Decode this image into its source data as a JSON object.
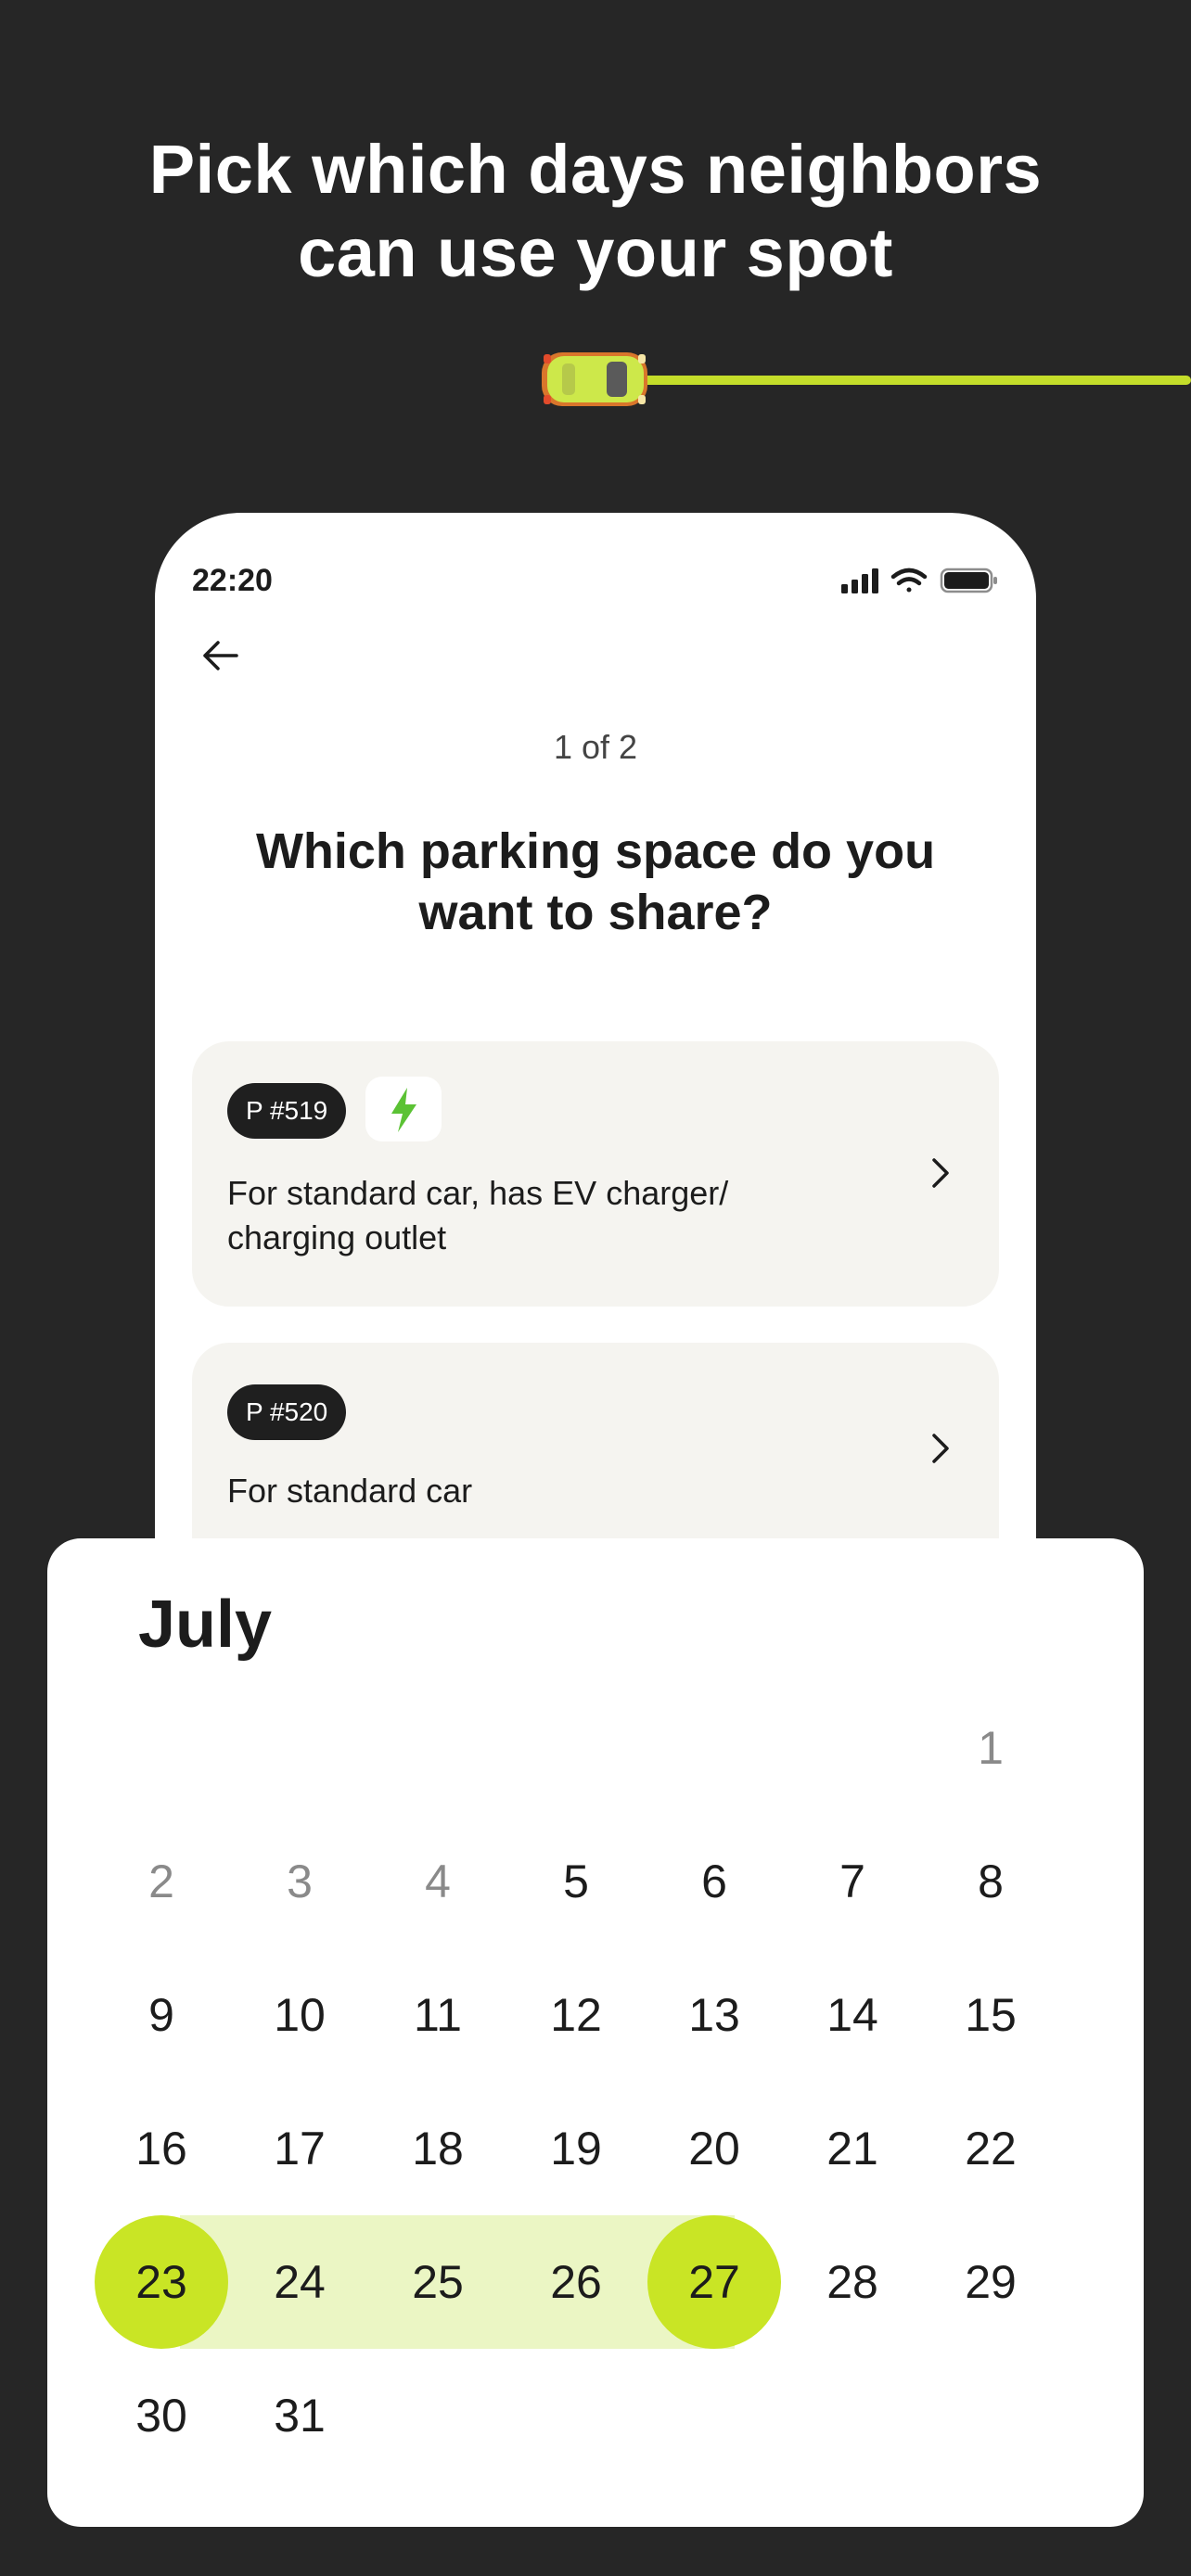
{
  "headline": {
    "line1": "Pick which days neighbors",
    "line2": "can use your spot"
  },
  "colors": {
    "background": "#262626",
    "accent": "#c4dd2a",
    "selected_day": "#c9e525",
    "range_fill": "#ebf6c4",
    "card_bg": "#f5f4f0"
  },
  "phone": {
    "status_time": "22:20",
    "status_icons": [
      "signal-icon",
      "wifi-icon",
      "battery-icon"
    ],
    "step": "1 of 2",
    "question_line1": "Which parking space do you",
    "question_line2": "want to share?",
    "spaces": [
      {
        "tag": "P #519",
        "has_ev_icon": true,
        "desc_line1": "For standard car, has EV charger/",
        "desc_line2": "charging outlet"
      },
      {
        "tag": "P #520",
        "has_ev_icon": false,
        "desc_line1": "For standard car",
        "desc_line2": ""
      }
    ]
  },
  "calendar": {
    "month": "July",
    "selected_start": 23,
    "selected_end": 27,
    "muted_days": [
      1,
      2,
      3,
      4
    ],
    "weeks": [
      [
        "",
        "",
        "",
        "",
        "",
        "",
        "1"
      ],
      [
        "2",
        "3",
        "4",
        "5",
        "6",
        "7",
        "8"
      ],
      [
        "9",
        "10",
        "11",
        "12",
        "13",
        "14",
        "15"
      ],
      [
        "16",
        "17",
        "18",
        "19",
        "20",
        "21",
        "22"
      ],
      [
        "23",
        "24",
        "25",
        "26",
        "27",
        "28",
        "29"
      ],
      [
        "30",
        "31",
        "",
        "",
        "",
        "",
        ""
      ]
    ]
  }
}
